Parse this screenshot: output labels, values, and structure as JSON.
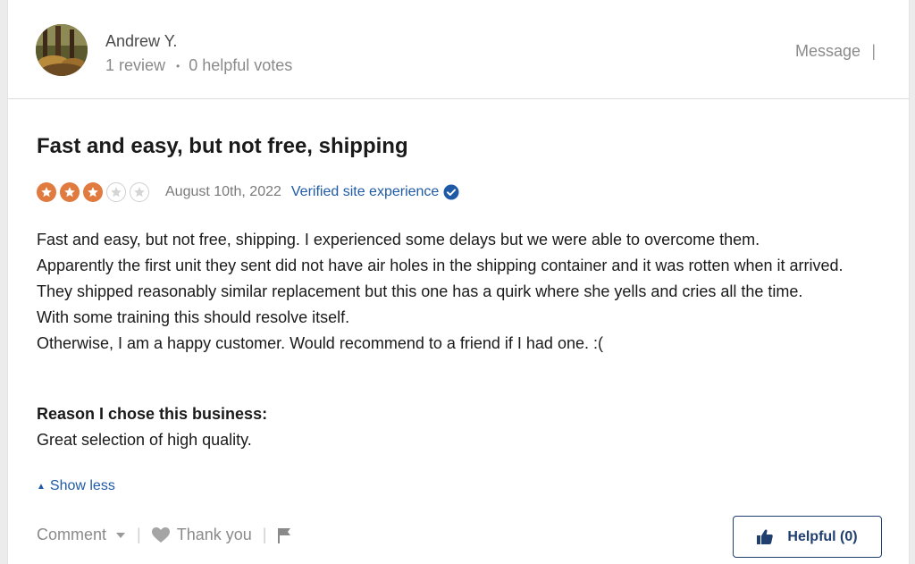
{
  "reviewer": {
    "name": "Andrew Y.",
    "review_count": "1 review",
    "separator": "•",
    "helpful_votes": "0 helpful votes",
    "message_label": "Message",
    "header_separator": "|"
  },
  "review": {
    "title": "Fast and easy, but not free, shipping",
    "rating": 3,
    "max_rating": 5,
    "date": "August 10th, 2022",
    "verified_label": "Verified site experience",
    "body_lines": [
      "Fast and easy, but not free, shipping. I experienced some delays but we were able to overcome them.",
      "Apparently the first unit they sent did not have air holes in the shipping container and it was rotten when it arrived.",
      "They shipped reasonably similar replacement but this one has a quirk where she yells and cries all the time.",
      "With some training this should resolve itself.",
      "Otherwise, I am a happy customer. Would recommend to a friend if I had one. :("
    ],
    "reason_label": "Reason I chose this business:",
    "reason_text": "Great selection of high quality.",
    "show_less_label": "Show less"
  },
  "actions": {
    "comment_label": "Comment",
    "thank_you_label": "Thank you",
    "separator": "|",
    "helpful_label": "Helpful (0)"
  },
  "colors": {
    "star_filled": "#e07a3f",
    "link_blue": "#1f5aa6",
    "helpful_border": "#1f3f6e"
  },
  "icons": [
    "avatar",
    "star-icon",
    "verified-check-icon",
    "caret-up-icon",
    "chevron-down-icon",
    "heart-icon",
    "flag-icon",
    "thumbs-up-icon"
  ]
}
